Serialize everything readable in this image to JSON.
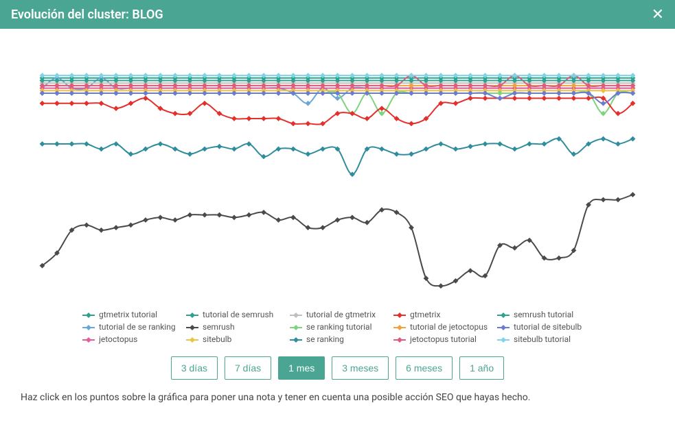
{
  "header": {
    "title": "Evolución del cluster: BLOG",
    "close_label": "✕"
  },
  "hint_text": "Haz click en los puntos sobre la gráfica para poner una nota y tener en cuenta una posible acción SEO que hayas hecho.",
  "range_buttons": [
    {
      "label": "3 días",
      "active": false
    },
    {
      "label": "7 días",
      "active": false
    },
    {
      "label": "1 mes",
      "active": true
    },
    {
      "label": "3 meses",
      "active": false
    },
    {
      "label": "6 meses",
      "active": false
    },
    {
      "label": "1 año",
      "active": false
    }
  ],
  "chart_data": {
    "type": "line",
    "title": "Evolución del cluster: BLOG",
    "xlabel": "",
    "ylabel": "",
    "x": [
      1,
      2,
      3,
      4,
      5,
      6,
      7,
      8,
      9,
      10,
      11,
      12,
      13,
      14,
      15,
      16,
      17,
      18,
      19,
      20,
      21,
      22,
      23,
      24,
      25,
      26,
      27,
      28,
      29,
      30,
      31,
      32,
      33,
      34,
      35,
      36,
      37,
      38,
      39,
      40,
      41
    ],
    "ylim": [
      0,
      100
    ],
    "series": [
      {
        "name": "gtmetrix tutorial",
        "color": "#2ea28f",
        "values": [
          86,
          86,
          86,
          86,
          86,
          86,
          86,
          86,
          86,
          86,
          86,
          86,
          86,
          86,
          86,
          86,
          86,
          86,
          86,
          86,
          86,
          86,
          86,
          86,
          86,
          86,
          86,
          86,
          86,
          86,
          86,
          86,
          86,
          86,
          86,
          86,
          86,
          86,
          86,
          86,
          86
        ]
      },
      {
        "name": "tutorial de se ranking",
        "color": "#6aa7d6",
        "values": [
          82,
          86,
          82,
          82,
          86,
          82,
          82,
          82,
          82,
          82,
          82,
          82,
          82,
          82,
          82,
          82,
          82,
          80,
          76,
          82,
          78,
          82,
          82,
          82,
          82,
          82,
          82,
          82,
          82,
          82,
          82,
          82,
          82,
          82,
          82,
          82,
          82,
          82,
          82,
          82,
          82
        ]
      },
      {
        "name": "jetoctopus",
        "color": "#e75a9a",
        "values": [
          82,
          82,
          82,
          82,
          82,
          82,
          82,
          82,
          82,
          82,
          82,
          82,
          82,
          82,
          82,
          82,
          82,
          82,
          82,
          82,
          82,
          82,
          82,
          82,
          82,
          82,
          82,
          82,
          82,
          82,
          82,
          82,
          82,
          82,
          82,
          82,
          82,
          82,
          82,
          82,
          82
        ]
      },
      {
        "name": "tutorial de semrush",
        "color": "#2ea28f",
        "values": [
          85,
          85,
          85,
          85,
          85,
          85,
          85,
          85,
          85,
          85,
          85,
          85,
          85,
          85,
          85,
          85,
          85,
          85,
          85,
          85,
          85,
          85,
          85,
          85,
          85,
          85,
          85,
          85,
          85,
          85,
          85,
          85,
          85,
          85,
          85,
          85,
          85,
          85,
          85,
          85,
          85
        ]
      },
      {
        "name": "semrush",
        "color": "#4a4a4a",
        "values": [
          12,
          17,
          26,
          28,
          26,
          27,
          28,
          30,
          31,
          30,
          32,
          32,
          32,
          31,
          32,
          33,
          30,
          31,
          27,
          27,
          30,
          31,
          29,
          34,
          33,
          27,
          7,
          4,
          6,
          10,
          8,
          20,
          19,
          22,
          15,
          15,
          18,
          36,
          38,
          38,
          40
        ]
      },
      {
        "name": "sitebulb",
        "color": "#f0c040",
        "values": [
          81,
          81,
          81,
          81,
          81,
          81,
          81,
          81,
          81,
          81,
          81,
          81,
          81,
          81,
          81,
          81,
          81,
          81,
          81,
          81,
          81,
          81,
          81,
          81,
          81,
          81,
          81,
          81,
          81,
          81,
          81,
          81,
          81,
          81,
          81,
          81,
          81,
          81,
          81,
          81,
          81
        ]
      },
      {
        "name": "tutorial de gtmetrix",
        "color": "#bfbfbf",
        "values": [
          84,
          84,
          84,
          84,
          84,
          84,
          84,
          84,
          84,
          84,
          84,
          84,
          84,
          84,
          84,
          84,
          84,
          84,
          84,
          84,
          84,
          84,
          84,
          84,
          84,
          84,
          84,
          84,
          84,
          84,
          84,
          84,
          84,
          84,
          84,
          84,
          84,
          84,
          84,
          84,
          84
        ]
      },
      {
        "name": "se ranking tutorial",
        "color": "#7ed37c",
        "values": [
          80,
          80,
          80,
          80,
          80,
          80,
          80,
          80,
          80,
          80,
          80,
          80,
          80,
          80,
          80,
          80,
          80,
          80,
          80,
          80,
          80,
          72,
          80,
          72,
          80,
          80,
          80,
          80,
          80,
          80,
          80,
          80,
          80,
          80,
          80,
          80,
          80,
          80,
          72,
          80,
          80
        ]
      },
      {
        "name": "se ranking",
        "color": "#2f8d9c",
        "values": [
          60,
          60,
          60,
          60,
          58,
          60,
          56,
          58,
          60,
          58,
          56,
          58,
          59,
          58,
          60,
          55,
          58,
          58,
          56,
          58,
          58,
          48,
          58,
          58,
          56,
          56,
          58,
          60,
          58,
          59,
          60,
          60,
          58,
          60,
          60,
          62,
          56,
          60,
          62,
          60,
          62
        ]
      },
      {
        "name": "gtmetrix",
        "color": "#e3302c",
        "values": [
          76,
          76,
          76,
          76,
          76,
          74,
          76,
          78,
          74,
          72,
          72,
          76,
          72,
          70,
          70,
          70,
          70,
          68,
          68,
          68,
          72,
          72,
          70,
          74,
          70,
          68,
          70,
          76,
          76,
          78,
          78,
          78,
          78,
          78,
          78,
          78,
          78,
          78,
          78,
          72,
          76
        ]
      },
      {
        "name": "tutorial de jetoctopus",
        "color": "#f2a23c",
        "values": [
          83,
          83,
          83,
          83,
          83,
          83,
          83,
          83,
          83,
          83,
          83,
          83,
          83,
          83,
          83,
          83,
          83,
          83,
          83,
          83,
          83,
          83,
          83,
          83,
          83,
          83,
          83,
          83,
          83,
          83,
          83,
          83,
          83,
          83,
          83,
          83,
          83,
          83,
          83,
          83,
          83
        ]
      },
      {
        "name": "jetoctopus tutorial",
        "color": "#dc5c7e",
        "values": [
          83,
          83,
          83,
          83,
          83,
          83,
          83,
          83,
          83,
          83,
          83,
          83,
          83,
          83,
          83,
          83,
          83,
          83,
          83,
          83,
          83,
          83,
          83,
          83,
          83,
          87,
          83,
          83,
          83,
          83,
          83,
          83,
          87,
          83,
          83,
          83,
          87,
          83,
          83,
          83,
          83
        ]
      },
      {
        "name": "semrush tutorial",
        "color": "#2ea28f",
        "values": [
          85,
          85,
          85,
          85,
          85,
          85,
          85,
          85,
          85,
          85,
          85,
          85,
          85,
          85,
          85,
          85,
          85,
          85,
          85,
          85,
          85,
          85,
          85,
          85,
          85,
          85,
          85,
          85,
          85,
          85,
          85,
          85,
          85,
          85,
          85,
          85,
          85,
          85,
          85,
          85,
          85
        ]
      },
      {
        "name": "tutorial de sitebulb",
        "color": "#6c7bd1",
        "values": [
          80,
          80,
          80,
          80,
          80,
          80,
          80,
          80,
          80,
          80,
          80,
          80,
          80,
          80,
          80,
          80,
          80,
          80,
          80,
          80,
          80,
          80,
          80,
          80,
          80,
          80,
          80,
          80,
          80,
          80,
          80,
          78,
          80,
          80,
          80,
          80,
          80,
          80,
          76,
          80,
          80
        ]
      },
      {
        "name": "sitebulb tutorial",
        "color": "#7ed4e6",
        "values": [
          87,
          87,
          87,
          87,
          87,
          87,
          87,
          87,
          87,
          87,
          87,
          87,
          87,
          87,
          87,
          87,
          87,
          87,
          87,
          87,
          87,
          87,
          87,
          87,
          87,
          87,
          87,
          87,
          87,
          87,
          87,
          87,
          87,
          87,
          87,
          87,
          87,
          87,
          87,
          87,
          87
        ]
      }
    ]
  },
  "legend_layout": [
    "gtmetrix tutorial",
    "tutorial de semrush",
    "tutorial de gtmetrix",
    "gtmetrix",
    "semrush tutorial",
    "tutorial de se ranking",
    "semrush",
    "se ranking tutorial",
    "tutorial de jetoctopus",
    "tutorial de sitebulb",
    "jetoctopus",
    "sitebulb",
    "se ranking",
    "jetoctopus tutorial",
    "sitebulb tutorial"
  ]
}
